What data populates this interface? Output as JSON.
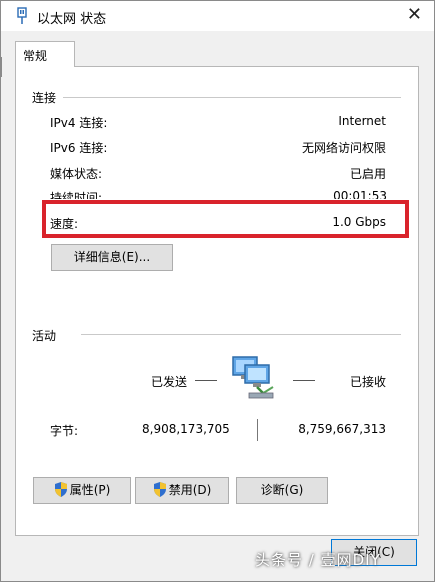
{
  "window": {
    "title": "以太网 状态",
    "close_glyph": "✕"
  },
  "tabs": [
    {
      "label": "常规"
    }
  ],
  "connection": {
    "group_title": "连接",
    "rows": [
      {
        "label": "IPv4 连接:",
        "value": "Internet"
      },
      {
        "label": "IPv6 连接:",
        "value": "无网络访问权限"
      },
      {
        "label": "媒体状态:",
        "value": "已启用"
      },
      {
        "label": "持续时间:",
        "value": "00:01:53"
      },
      {
        "label": "速度:",
        "value": "1.0 Gbps"
      }
    ],
    "details_button": "详细信息(E)..."
  },
  "activity": {
    "group_title": "活动",
    "sent_label": "已发送",
    "received_label": "已接收",
    "bytes_label": "字节:",
    "bytes_sent": "8,908,173,705",
    "bytes_received": "8,759,667,313"
  },
  "buttons": {
    "properties": "属性(P)",
    "disable": "禁用(D)",
    "diagnose": "诊断(G)",
    "close": "关闭(C)"
  },
  "highlight_color": "#d9232b",
  "watermark": "头条号 / 壹网DIY",
  "icons": [
    "network-adapter-icon",
    "network-computers-icon",
    "shield-icon",
    "close-icon"
  ]
}
